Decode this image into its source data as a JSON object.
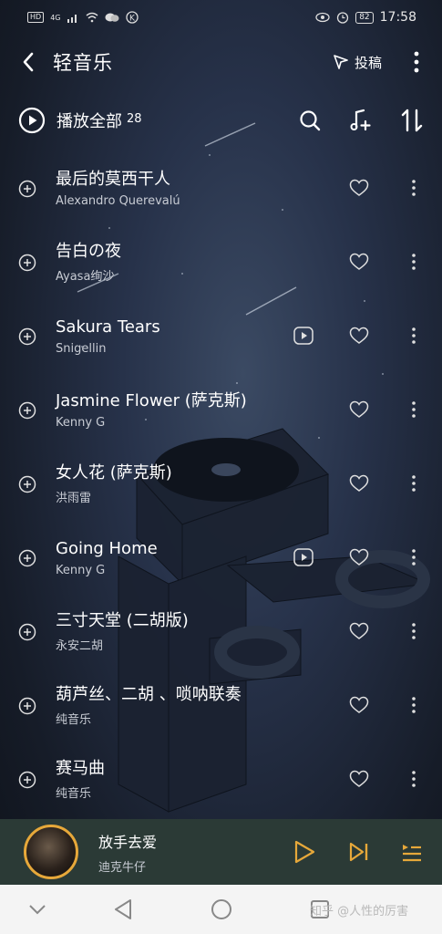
{
  "status_bar": {
    "left_badges": [
      "HD",
      "4G"
    ],
    "battery": "82",
    "time": "17:58"
  },
  "header": {
    "title": "轻音乐",
    "submit_label": "投稿"
  },
  "play_all": {
    "label": "播放全部",
    "count": "28"
  },
  "songs": [
    {
      "title": "最后的莫西干人",
      "artist": "Alexandro Querevalú",
      "has_mv": false
    },
    {
      "title": "告白の夜",
      "artist": "Ayasa绚沙",
      "has_mv": false
    },
    {
      "title": "Sakura Tears",
      "artist": "Snigellin",
      "has_mv": true
    },
    {
      "title": "Jasmine Flower (萨克斯)",
      "artist": "Kenny G",
      "has_mv": false
    },
    {
      "title": "女人花 (萨克斯)",
      "artist": "洪雨雷",
      "has_mv": false
    },
    {
      "title": "Going Home",
      "artist": "Kenny G",
      "has_mv": true
    },
    {
      "title": "三寸天堂 (二胡版)",
      "artist": "永安二胡",
      "has_mv": false
    },
    {
      "title": "葫芦丝、二胡 、唢呐联奏",
      "artist": "纯音乐",
      "has_mv": false
    },
    {
      "title": "赛马曲",
      "artist": "纯音乐",
      "has_mv": false
    }
  ],
  "now_playing": {
    "title": "放手去爱",
    "artist": "迪克牛仔"
  },
  "watermark": "知乎 @人性的厉害",
  "colors": {
    "accent": "#e7a83a",
    "mini_player_bg": "#2b3a36",
    "nav_bg": "#f4f4f4"
  },
  "icons": {
    "back": "chevron-left-icon",
    "submit": "send-icon",
    "more": "more-vertical-icon",
    "play_all": "play-circle-icon",
    "search": "search-icon",
    "add_song": "music-plus-icon",
    "sort": "sort-icon",
    "row_add": "add-circle-icon",
    "mv": "mv-icon",
    "like": "heart-icon",
    "play": "play-icon",
    "next": "skip-next-icon",
    "playlist": "playlist-icon"
  }
}
